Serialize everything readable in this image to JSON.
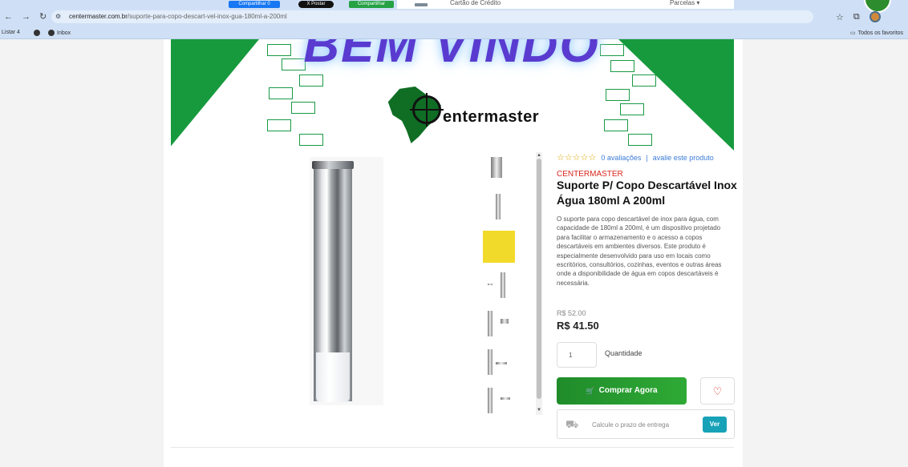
{
  "browser": {
    "share_buttons": [
      "Compartilhar 0",
      "X Postar",
      "Compartilhar"
    ],
    "ad_strip": {
      "text": "Cartão de Crédito",
      "right": "Parcelas ▾"
    },
    "url_host": "centermaster.com.br",
    "url_path": "/suporte-para-copo-descart-vel-inox-gua-180ml-a-200ml",
    "bookmarks": [
      "Listar 4",
      "Inbox"
    ],
    "bookmarks_right": "Todos os favoritos"
  },
  "banner": {
    "headline": "BEM VINDO",
    "logo_text": "entermaster"
  },
  "product": {
    "stars": "☆☆☆☆☆",
    "reviews": "0 avaliações",
    "separator": "|",
    "rate_link": "avalie este produto",
    "brand": "CENTERMASTER",
    "title": "Suporte P/ Copo Descartável Inox Água 180ml A 200ml",
    "description": "O suporte para copo descartável de inox para água, com capacidade de 180ml a 200ml, é um dispositivo projetado para facilitar o armazenamento e o acesso a copos descartáveis em ambientes diversos. Este produto é especialmente desenvolvido para uso em locais como escritórios, consultórios, cozinhas, eventos e outras áreas onde a disponibilidade de água em copos descartáveis é necessária.",
    "old_price": "R$ 52.00",
    "price": "R$ 41.50",
    "quantity": "1",
    "quantity_label": "Quantidade",
    "buy_label": "Comprar Agora",
    "shipping_placeholder": "Calcule o prazo de entrega",
    "shipping_button": "Ver"
  },
  "colors": {
    "brand_green": "#179a3d",
    "buy_green": "#2faa36",
    "brand_red": "#d9261c",
    "link_blue": "#3b7bd6",
    "ver_teal": "#17a2b8"
  }
}
